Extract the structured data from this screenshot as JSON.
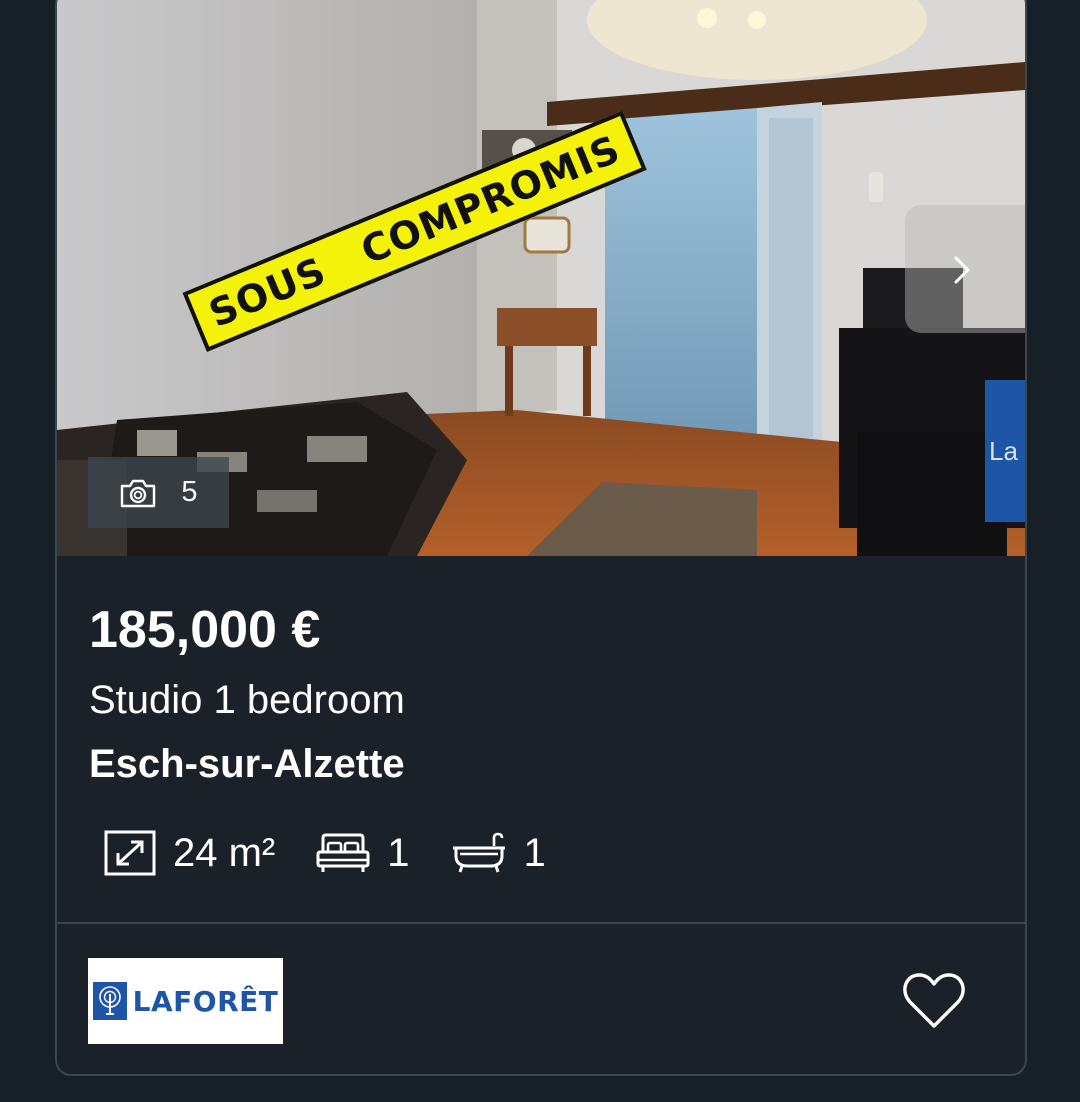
{
  "listing": {
    "stamp_text": "SOUS   COMPROMIS",
    "photo_count": "5",
    "price": "185,000 €",
    "property_type": "Studio 1 bedroom",
    "location": "Esch-sur-Alzette",
    "features": {
      "area": "24 m²",
      "bedrooms": "1",
      "bathrooms": "1"
    }
  },
  "agency": {
    "logo_text": "LAFORÊT",
    "peek_logo_text": "La"
  },
  "icons": {
    "photo_count": "camera-icon",
    "next": "chevron-right-icon",
    "area": "resize-diagonal-icon",
    "bedrooms": "bed-icon",
    "bathrooms": "bathtub-icon",
    "favorite": "heart-outline-icon"
  },
  "colors": {
    "page_bg": "#182027",
    "card_bg": "#1a2128",
    "card_border": "#3a4650",
    "stamp_yellow": "#f5f20a",
    "agency_blue": "#1f55a6"
  }
}
